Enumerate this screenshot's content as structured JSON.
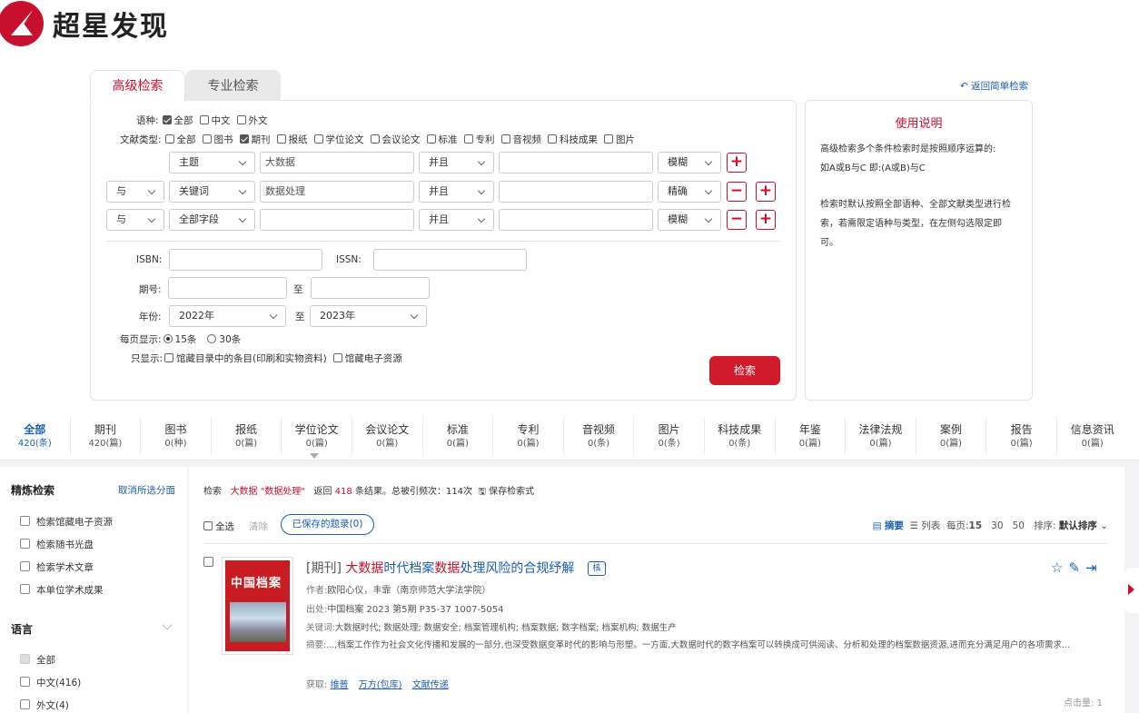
{
  "brand": {
    "name": "超星发现",
    "color": "#c8102e"
  },
  "tabs": {
    "advanced": "高级检索",
    "professional": "专业检索"
  },
  "back_link": "返回简单检索",
  "form": {
    "lang_label": "语种:",
    "lang_options": [
      {
        "label": "全部",
        "checked": true
      },
      {
        "label": "中文",
        "checked": false
      },
      {
        "label": "外文",
        "checked": false
      }
    ],
    "doctype_label": "文献类型:",
    "doctype_options": [
      {
        "label": "全部",
        "checked": false
      },
      {
        "label": "图书",
        "checked": false
      },
      {
        "label": "期刊",
        "checked": true
      },
      {
        "label": "报纸",
        "checked": false
      },
      {
        "label": "学位论文",
        "checked": false
      },
      {
        "label": "会议论文",
        "checked": false
      },
      {
        "label": "标准",
        "checked": false
      },
      {
        "label": "专利",
        "checked": false
      },
      {
        "label": "音视频",
        "checked": false
      },
      {
        "label": "科技成果",
        "checked": false
      },
      {
        "label": "图片",
        "checked": false
      }
    ],
    "conditions": [
      {
        "bool": "",
        "field": "主题",
        "value": "大数据",
        "op": "并且",
        "value2": "",
        "match": "模糊"
      },
      {
        "bool": "与",
        "field": "关键词",
        "value": "数据处理",
        "op": "并且",
        "value2": "",
        "match": "精确"
      },
      {
        "bool": "与",
        "field": "全部字段",
        "value": "",
        "op": "并且",
        "value2": "",
        "match": "模糊"
      }
    ],
    "isbn_label": "ISBN:",
    "issn_label": "ISSN:",
    "issue_label": "期号:",
    "to": "至",
    "year_label": "年份:",
    "year_from": "2022年",
    "year_to": "2023年",
    "per_page_label": "每页显示:",
    "per_page_15": "15条",
    "per_page_30": "30条",
    "show_only_label": "只显示:",
    "show_only_1": "馆藏目录中的条目(印刷和实物资料)",
    "show_only_2": "馆藏电子资源",
    "search_button": "检索"
  },
  "help": {
    "title": "使用说明",
    "p1": "高级检索多个条件检索时是按照顺序运算的:",
    "p2": "如A或B与C 即:(A或B)与C",
    "p3": "检索时默认按照全部语种、全部文献类型进行检索，若需限定语种与类型，在左侧勾选限定即可。"
  },
  "categories": [
    {
      "name": "全部",
      "count": "420(条)",
      "active": true
    },
    {
      "name": "期刊",
      "count": "420(篇)"
    },
    {
      "name": "图书",
      "count": "0(种)"
    },
    {
      "name": "报纸",
      "count": "0(篇)"
    },
    {
      "name": "学位论文",
      "count": "0(篇)"
    },
    {
      "name": "会议论文",
      "count": "0(篇)"
    },
    {
      "name": "标准",
      "count": "0(篇)"
    },
    {
      "name": "专利",
      "count": "0(篇)"
    },
    {
      "name": "音视频",
      "count": "0(条)"
    },
    {
      "name": "图片",
      "count": "0(条)"
    },
    {
      "name": "科技成果",
      "count": "0(条)"
    },
    {
      "name": "年鉴",
      "count": "0(篇)"
    },
    {
      "name": "法律法规",
      "count": "0(篇)"
    },
    {
      "name": "案例",
      "count": "0(篇)"
    },
    {
      "name": "报告",
      "count": "0(篇)"
    },
    {
      "name": "信息资讯",
      "count": "0(篇)"
    }
  ],
  "sidebar": {
    "title": "精炼检索",
    "clear": "取消所选分面",
    "items": [
      "检索馆藏电子资源",
      "检索随书光盘",
      "检索学术文章",
      "本单位学术成果"
    ],
    "lang_title": "语言",
    "lang_items": [
      "全部",
      "中文(416)",
      "外文(4)"
    ]
  },
  "results": {
    "prefix": "检索",
    "query": "大数据 \"数据处理\"",
    "returned": "返回",
    "count": "418",
    "suffix": "条结果。总被引频次：114次",
    "save": "保存检索式",
    "select_all": "全选",
    "clear": "清除",
    "saved": "已保存的题录(0)",
    "view_abstract": "摘要",
    "view_list": "列表",
    "per_page": "每页:",
    "pp15": "15",
    "pp30": "30",
    "pp50": "50",
    "sort_label": "排序:",
    "sort_value": "默认排序"
  },
  "item": {
    "cover_title": "中国档案",
    "type": "[期刊]",
    "title_1": "大数据",
    "title_2": "时代档案",
    "title_3": "数据",
    "title_4": "处理风险的合规纾解",
    "core_badge": "核",
    "authors_label": "作者:",
    "authors": "欧阳心仪，丰霏（南京师范大学法学院）",
    "source_label": "出处:",
    "source": "中国档案 2023 第5期 P35-37  1007-5054",
    "keywords_label": "关键词:",
    "keywords": "大数据时代; 数据处理; 数据安全; 档案管理机构; 档案数据; 数字档案; 档案机构; 数据生产",
    "abstract_label": "摘要:",
    "abstract": "...,档案工作作为社会文化传播和发展的一部分,也深受数据变革时代的影响与形塑。一方面,大数据时代的数字档案可以转换成可供阅读、分析和处理的档案数据资源,进而充分满足用户的各项需求...",
    "get_label": "获取:",
    "get_links": [
      "维普",
      "万方(包库)",
      "文献传递"
    ],
    "clicks": "点击量: 1"
  }
}
